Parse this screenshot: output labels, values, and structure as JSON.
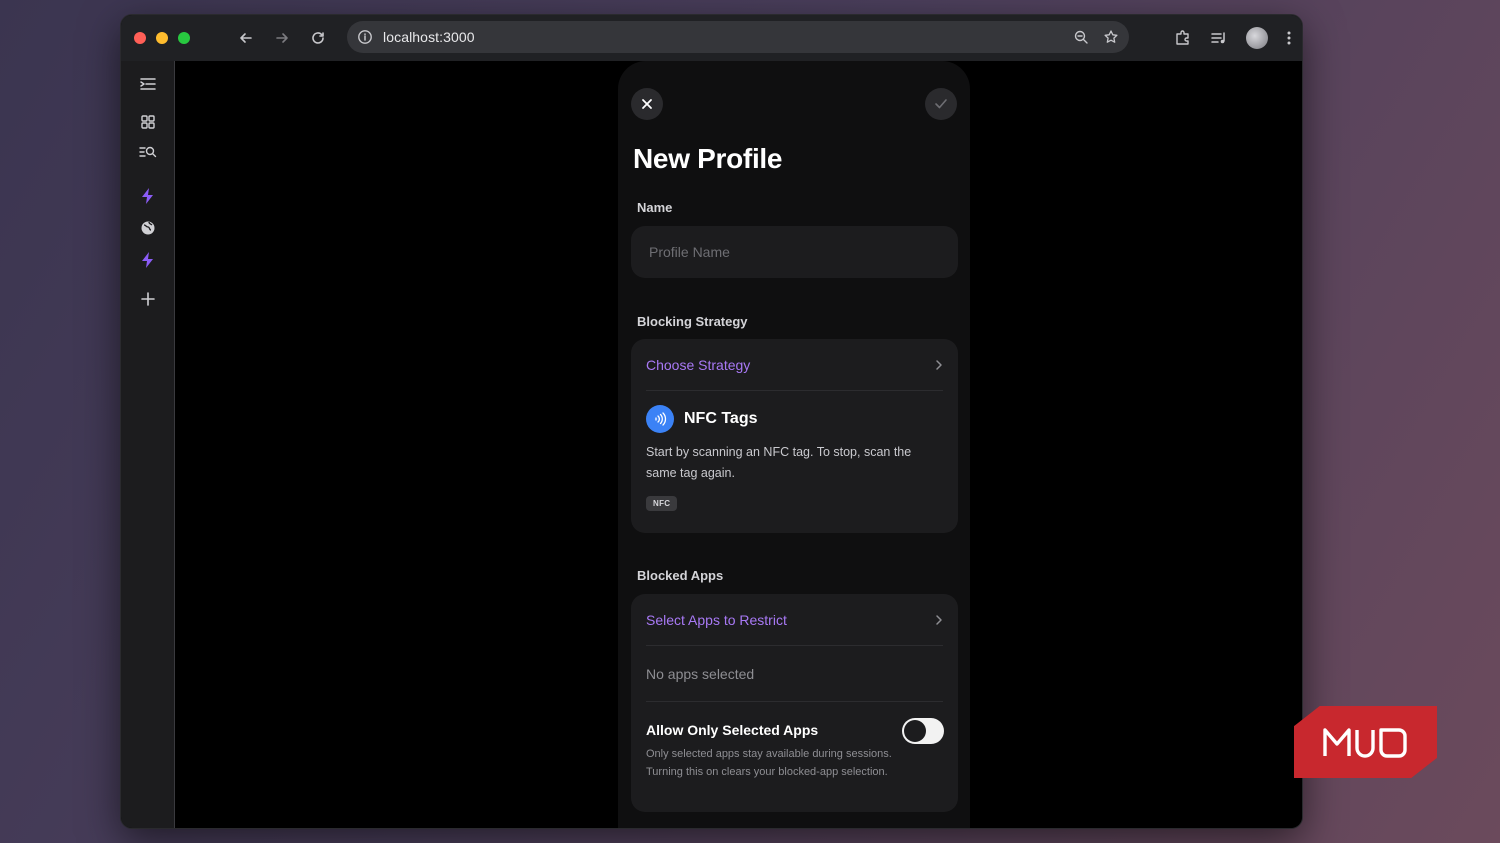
{
  "browser": {
    "url": "localhost:3000"
  },
  "panel": {
    "title": "New Profile",
    "name_label": "Name",
    "name_placeholder": "Profile Name",
    "blocking_label": "Blocking Strategy",
    "choose_strategy": "Choose Strategy",
    "strategy": {
      "title": "NFC Tags",
      "description": "Start by scanning an NFC tag. To stop, scan the same tag again.",
      "badge": "NFC"
    },
    "blocked_apps_label": "Blocked Apps",
    "select_apps": "Select Apps to Restrict",
    "no_apps": "No apps selected",
    "allow_only_title": "Allow Only Selected Apps",
    "allow_only_desc": "Only selected apps stay available during sessions. Turning this on clears your blocked-app selection.",
    "allow_only_enabled": false
  },
  "colors": {
    "accent": "#a879f5",
    "nfc_icon": "#3b82f6",
    "sidebar_bolt": "#8b5cf6",
    "watermark": "#c8282e"
  },
  "watermark": {
    "text": "MUO"
  }
}
